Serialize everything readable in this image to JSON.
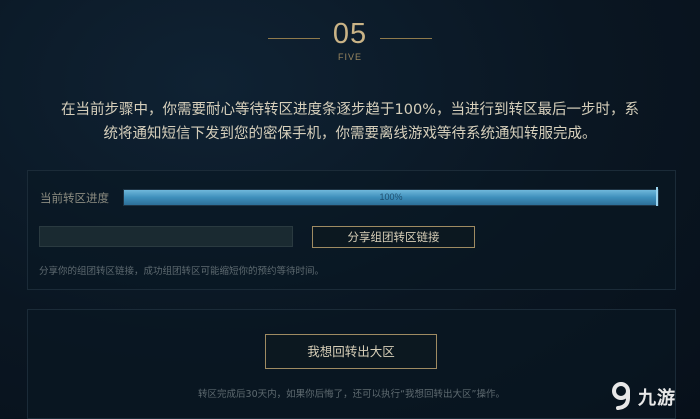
{
  "step": {
    "number": "05",
    "word": "FIVE"
  },
  "instructions": {
    "line1": "在当前步骤中，你需要耐心等待转区进度条逐步趋于100%，当进行到转区最后一步时，系",
    "line2": "统将通知短信下发到您的密保手机，你需要离线游戏等待系统通知转服完成。"
  },
  "progress": {
    "label": "当前转区进度",
    "percent_text": "100%",
    "value": 1.0
  },
  "share": {
    "input_value": "",
    "button_label": "分享组团转区链接",
    "hint": "分享你的组团转区链接，成功组团转区可能缩短你的预约等待时间。"
  },
  "return": {
    "button_label": "我想回转出大区",
    "hint": "转区完成后30天内，如果你后悔了，还可以执行“我想回转出大区”操作。"
  },
  "watermark": {
    "text": "九游"
  },
  "colors": {
    "accent_gold": "#9f8b62",
    "progress_blue": "#3e8fbb",
    "background": "#0a1622"
  }
}
